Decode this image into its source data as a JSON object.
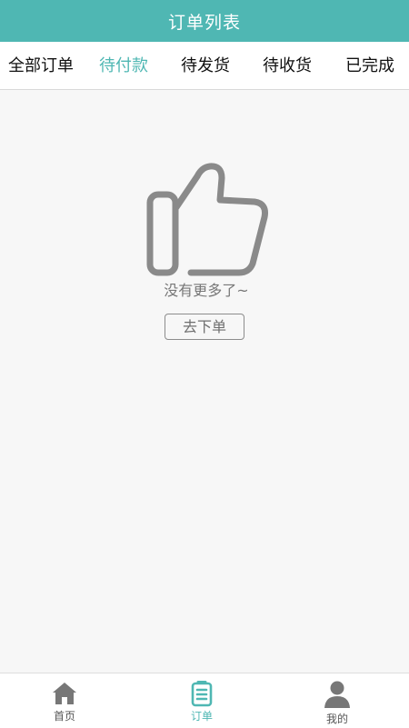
{
  "header": {
    "title": "订单列表"
  },
  "tabs": [
    {
      "label": "全部订单",
      "active": false
    },
    {
      "label": "待付款",
      "active": true
    },
    {
      "label": "待发货",
      "active": false
    },
    {
      "label": "待收货",
      "active": false
    },
    {
      "label": "已完成",
      "active": false
    }
  ],
  "empty_state": {
    "icon": "thumbs-up-icon",
    "message": "没有更多了~",
    "button_label": "去下单"
  },
  "bottom_nav": [
    {
      "label": "首页",
      "icon": "home-icon",
      "active": false
    },
    {
      "label": "订单",
      "icon": "order-list-icon",
      "active": true
    },
    {
      "label": "我的",
      "icon": "user-icon",
      "active": false
    }
  ],
  "colors": {
    "accent": "#4fb7b3",
    "background": "#f7f7f7",
    "icon_gray": "#8a8a8a"
  }
}
